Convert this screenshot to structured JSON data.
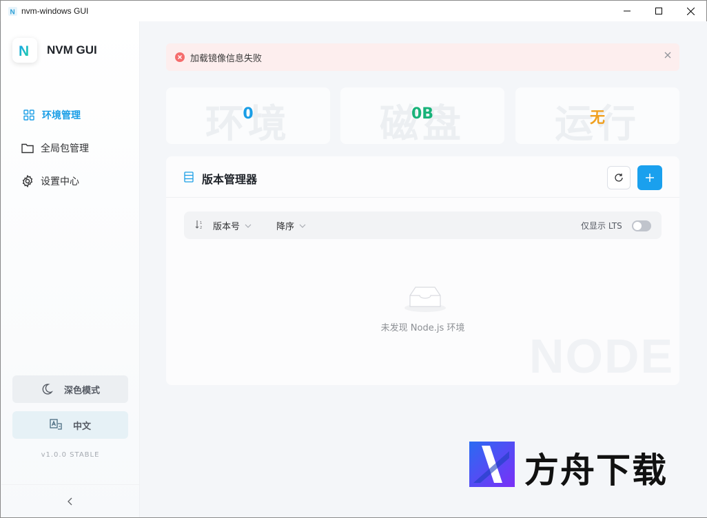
{
  "window": {
    "title": "nvm-windows GUI"
  },
  "brand": {
    "name": "NVM GUI",
    "logo_letter": "N"
  },
  "sidebar": {
    "items": [
      {
        "label": "环境管理",
        "icon": "grid-icon",
        "active": true
      },
      {
        "label": "全局包管理",
        "icon": "folder-icon",
        "active": false
      },
      {
        "label": "设置中心",
        "icon": "gear-icon",
        "active": false
      }
    ],
    "dark_mode_label": "深色模式",
    "language_label": "中文",
    "version": "v1.0.0 STABLE"
  },
  "alert": {
    "message": "加载镜像信息失败",
    "type": "error"
  },
  "stats": [
    {
      "bg_word": "环境",
      "value": "0",
      "color": "#1a9ee6"
    },
    {
      "bg_word": "磁盘",
      "value": "0B",
      "color": "#19b37a"
    },
    {
      "bg_word": "运行",
      "value": "无",
      "color": "#f0a020"
    }
  ],
  "panel": {
    "title": "版本管理器",
    "sort_field": "版本号",
    "sort_order": "降序",
    "lts_label": "仅显示 LTS",
    "lts_enabled": false,
    "empty_text": "未发现 Node.js 环境",
    "watermark": "NODE"
  },
  "overlay_watermark": {
    "text": "方舟下载"
  },
  "colors": {
    "accent": "#1aa0ee",
    "alert_bg": "#fdeeee",
    "error": "#f56c6c"
  }
}
